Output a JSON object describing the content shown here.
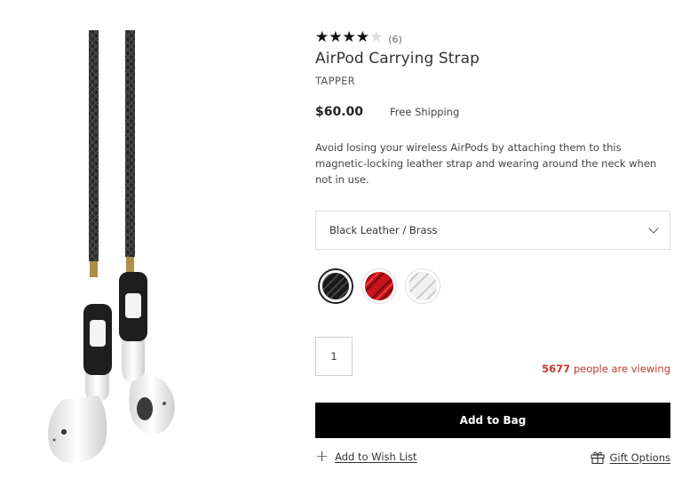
{
  "product": {
    "rating": {
      "value": 4,
      "max": 5,
      "count_text": "(6)"
    },
    "title": "AirPod Carrying Strap",
    "brand": "TAPPER",
    "price": "$60.00",
    "shipping": "Free Shipping",
    "description": "Avoid losing your wireless AirPods by attaching them to this magnetic-locking leather strap and wearing around the neck when not in use."
  },
  "variant_select": {
    "selected": "Black Leather / Brass"
  },
  "swatches": [
    {
      "name": "black",
      "color": "#1a1a1a",
      "selected": true
    },
    {
      "name": "red",
      "color": "#c8141c",
      "selected": false
    },
    {
      "name": "white",
      "color": "#f2f2f2",
      "selected": false
    }
  ],
  "quantity": {
    "value": "1"
  },
  "viewing": {
    "count": "5677",
    "text": " people are viewing"
  },
  "actions": {
    "add_to_bag": "Add to Bag",
    "wish_list": "Add to Wish List",
    "gift_options": "Gift Options"
  },
  "colors": {
    "accent_red": "#c0392b",
    "button_bg": "#000000"
  }
}
